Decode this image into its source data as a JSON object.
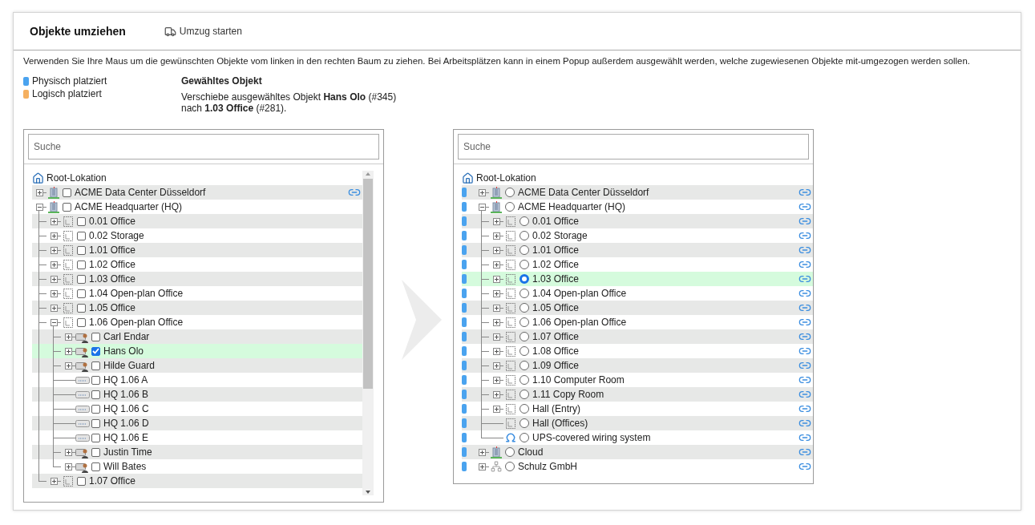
{
  "header": {
    "title": "Objekte umziehen",
    "action": "Umzug starten"
  },
  "instructions": "Verwenden Sie Ihre Maus um die gewünschten Objekte vom linken in den rechten Baum zu ziehen. Bei Arbeitsplätzen kann in einem Popup außerdem ausgewählt werden, welche zugewiesenen Objekte mit-umgezogen werden sollen.",
  "legend": [
    {
      "label": "Physisch platziert",
      "color": "#4aa3ef"
    },
    {
      "label": "Logisch platziert",
      "color": "#f5b060"
    }
  ],
  "selection": {
    "title": "Gewähltes Objekt",
    "lines": [
      "Verschiebe ausgewähltes Objekt **Hans Olo** (#345)",
      "nach **1.03 Office** (#281)."
    ]
  },
  "source_tree": {
    "search_placeholder": "Suche",
    "root": "Root-Lokation",
    "items": [
      {
        "label": "ACME Data Center Düsseldorf",
        "kind": "building",
        "expanded": false,
        "checked": false,
        "selected": false,
        "linked": true
      },
      {
        "label": "ACME Headquarter (HQ)",
        "kind": "building",
        "expanded": true,
        "checked": false,
        "selected": false,
        "linked": false,
        "children": [
          {
            "label": "0.01 Office",
            "kind": "room",
            "expanded": false,
            "checked": false,
            "selected": false,
            "linked": false
          },
          {
            "label": "0.02 Storage",
            "kind": "room",
            "expanded": false,
            "checked": false,
            "selected": false,
            "linked": false
          },
          {
            "label": "1.01 Office",
            "kind": "room",
            "expanded": false,
            "checked": false,
            "selected": false,
            "linked": false
          },
          {
            "label": "1.02 Office",
            "kind": "room",
            "expanded": false,
            "checked": false,
            "selected": false,
            "linked": false
          },
          {
            "label": "1.03 Office",
            "kind": "room",
            "expanded": false,
            "checked": false,
            "selected": false,
            "linked": false
          },
          {
            "label": "1.04 Open-plan Office",
            "kind": "room",
            "expanded": false,
            "checked": false,
            "selected": false,
            "linked": false
          },
          {
            "label": "1.05 Office",
            "kind": "room",
            "expanded": false,
            "checked": false,
            "selected": false,
            "linked": false
          },
          {
            "label": "1.06 Open-plan Office",
            "kind": "room",
            "expanded": true,
            "checked": false,
            "selected": false,
            "linked": false,
            "children": [
              {
                "label": "Carl Endar",
                "kind": "person",
                "expanded": false,
                "checked": false,
                "selected": false,
                "linked": false
              },
              {
                "label": "Hans Olo",
                "kind": "person",
                "expanded": false,
                "checked": true,
                "selected": true,
                "linked": false
              },
              {
                "label": "Hilde Guard",
                "kind": "person",
                "expanded": false,
                "checked": false,
                "selected": false,
                "linked": false
              },
              {
                "label": "HQ 1.06 A",
                "kind": "workstation",
                "checked": false,
                "selected": false,
                "linked": false
              },
              {
                "label": "HQ 1.06 B",
                "kind": "workstation",
                "checked": false,
                "selected": false,
                "linked": false
              },
              {
                "label": "HQ 1.06 C",
                "kind": "workstation",
                "checked": false,
                "selected": false,
                "linked": false
              },
              {
                "label": "HQ 1.06 D",
                "kind": "workstation",
                "checked": false,
                "selected": false,
                "linked": false
              },
              {
                "label": "HQ 1.06 E",
                "kind": "workstation",
                "checked": false,
                "selected": false,
                "linked": false
              },
              {
                "label": "Justin Time",
                "kind": "person",
                "expanded": false,
                "checked": false,
                "selected": false,
                "linked": false
              },
              {
                "label": "Will Bates",
                "kind": "person",
                "expanded": false,
                "checked": false,
                "selected": false,
                "linked": false
              }
            ]
          },
          {
            "label": "1.07 Office",
            "kind": "room",
            "expanded": false,
            "checked": false,
            "selected": false,
            "linked": false
          }
        ]
      }
    ]
  },
  "target_tree": {
    "search_placeholder": "Suche",
    "root": "Root-Lokation",
    "items": [
      {
        "label": "ACME Data Center Düsseldorf",
        "kind": "building",
        "expanded": false,
        "selected": false,
        "linked": true,
        "color": "#4aa3ef"
      },
      {
        "label": "ACME Headquarter (HQ)",
        "kind": "building",
        "expanded": true,
        "selected": false,
        "linked": true,
        "color": "#4aa3ef",
        "children": [
          {
            "label": "0.01 Office",
            "kind": "room",
            "expanded": false,
            "selected": false,
            "linked": true,
            "color": "#4aa3ef"
          },
          {
            "label": "0.02 Storage",
            "kind": "room",
            "expanded": false,
            "selected": false,
            "linked": true,
            "color": "#4aa3ef"
          },
          {
            "label": "1.01 Office",
            "kind": "room",
            "expanded": false,
            "selected": false,
            "linked": true,
            "color": "#4aa3ef"
          },
          {
            "label": "1.02 Office",
            "kind": "room",
            "expanded": false,
            "selected": false,
            "linked": true,
            "color": "#4aa3ef"
          },
          {
            "label": "1.03 Office",
            "kind": "room",
            "expanded": false,
            "selected": true,
            "linked": true,
            "color": "#4aa3ef"
          },
          {
            "label": "1.04 Open-plan Office",
            "kind": "room",
            "expanded": false,
            "selected": false,
            "linked": true,
            "color": "#4aa3ef"
          },
          {
            "label": "1.05 Office",
            "kind": "room",
            "expanded": false,
            "selected": false,
            "linked": true,
            "color": "#4aa3ef"
          },
          {
            "label": "1.06 Open-plan Office",
            "kind": "room",
            "expanded": false,
            "selected": false,
            "linked": true,
            "color": "#4aa3ef"
          },
          {
            "label": "1.07 Office",
            "kind": "room",
            "expanded": false,
            "selected": false,
            "linked": true,
            "color": "#4aa3ef"
          },
          {
            "label": "1.08 Office",
            "kind": "room",
            "expanded": false,
            "selected": false,
            "linked": true,
            "color": "#4aa3ef"
          },
          {
            "label": "1.09 Office",
            "kind": "room",
            "expanded": false,
            "selected": false,
            "linked": true,
            "color": "#4aa3ef"
          },
          {
            "label": "1.10 Computer Room",
            "kind": "room",
            "expanded": false,
            "selected": false,
            "linked": true,
            "color": "#4aa3ef"
          },
          {
            "label": "1.11 Copy Room",
            "kind": "room",
            "expanded": false,
            "selected": false,
            "linked": true,
            "color": "#4aa3ef"
          },
          {
            "label": "Hall (Entry)",
            "kind": "room",
            "expanded": false,
            "selected": false,
            "linked": true,
            "color": "#4aa3ef"
          },
          {
            "label": "Hall (Offices)",
            "kind": "room",
            "selected": false,
            "linked": true,
            "color": "#4aa3ef"
          },
          {
            "label": "UPS-covered wiring system",
            "kind": "system",
            "selected": false,
            "linked": true,
            "color": "#4aa3ef"
          }
        ]
      },
      {
        "label": "Cloud",
        "kind": "building",
        "expanded": false,
        "selected": false,
        "linked": true,
        "color": "#4aa3ef"
      },
      {
        "label": "Schulz GmbH",
        "kind": "company",
        "expanded": false,
        "selected": false,
        "linked": true,
        "color": "#4aa3ef"
      }
    ]
  }
}
